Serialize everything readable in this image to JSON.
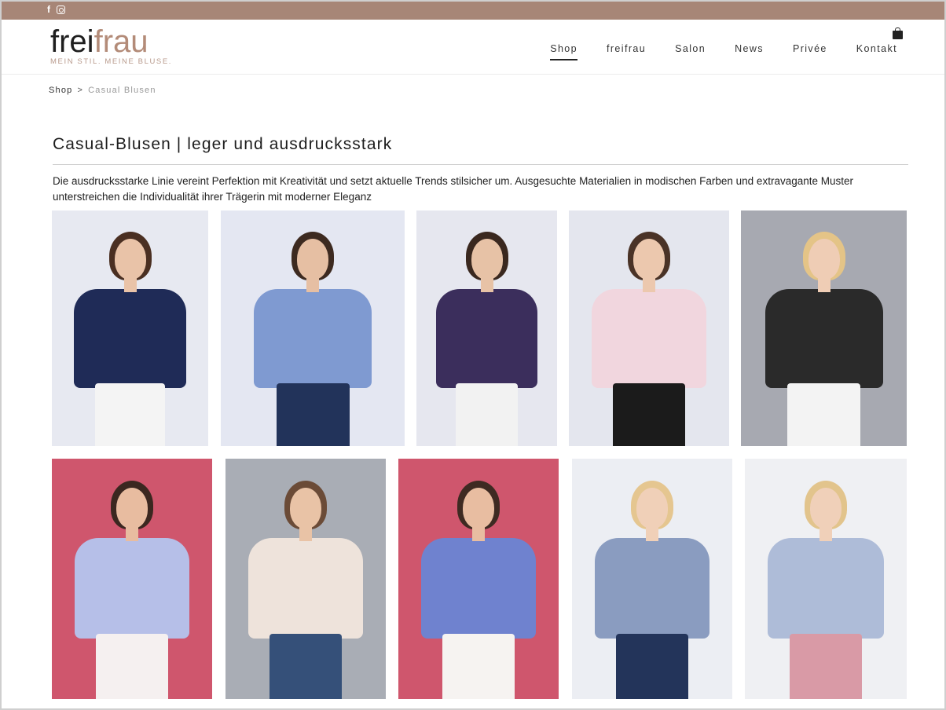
{
  "social": {
    "facebook_icon": "facebook-icon",
    "instagram_icon": "instagram-icon"
  },
  "logo": {
    "part1": "frei",
    "part2": "frau",
    "tagline": "MEIN STIL. MEINE BLUSE."
  },
  "nav": [
    "Shop",
    "freifrau",
    "Salon",
    "News",
    "Privée",
    "Kontakt"
  ],
  "nav_active": "Shop",
  "breadcrumb": {
    "parent": "Shop",
    "separator": ">",
    "current": "Casual Blusen"
  },
  "page": {
    "title": "Casual-Blusen | leger und ausdrucksstark",
    "intro": "Die ausdrucksstarke Linie vereint Perfektion mit Kreativität und setzt aktuelle Trends stilsicher um. Ausgesuchte Materialien in modischen Farben und extravagante Muster unterstreichen die Individualität ihrer Trägerin mit moderner Eleganz"
  },
  "colors": {
    "topbar": "#a78677",
    "logo_accent": "#b38b78"
  },
  "products": [
    {
      "bg": "#e7e9f1",
      "hair": "#4a2f22",
      "skin": "#e9c3a8",
      "top": "#1f2b57",
      "bottom": "#f4f4f4"
    },
    {
      "bg": "#e4e7f2",
      "hair": "#3d2a20",
      "skin": "#e6bfa3",
      "top": "#7f9ad1",
      "bottom": "#22335a"
    },
    {
      "bg": "#e6e7ef",
      "hair": "#3a281f",
      "skin": "#e7c2a6",
      "top": "#3b2e5c",
      "bottom": "#f2f2f2"
    },
    {
      "bg": "#e4e6ee",
      "hair": "#4a3327",
      "skin": "#ecc8ae",
      "top": "#f1d6de",
      "bottom": "#1b1b1b"
    },
    {
      "bg": "#a7a9b1",
      "hair": "#e4c487",
      "skin": "#efcdb5",
      "top": "#2a2a2a",
      "bottom": "#f3f3f3"
    },
    {
      "bg": "#cf566d",
      "hair": "#3b2720",
      "skin": "#e8bca0",
      "top": "#b6bfe8",
      "bottom": "#f5f0f0"
    },
    {
      "bg": "#a9adb5",
      "hair": "#6b4b37",
      "skin": "#e9c3a6",
      "top": "#eee3db",
      "bottom": "#355079"
    },
    {
      "bg": "#cf566d",
      "hair": "#3e2a22",
      "skin": "#e8bda1",
      "top": "#6f82cf",
      "bottom": "#f6f3f1"
    },
    {
      "bg": "#eceef3",
      "hair": "#e5c690",
      "skin": "#f0d0b8",
      "top": "#8a9cc0",
      "bottom": "#23345a"
    },
    {
      "bg": "#eff0f3",
      "hair": "#e2c48c",
      "skin": "#f0d0b9",
      "top": "#aebcd8",
      "bottom": "#d99aa6"
    }
  ]
}
